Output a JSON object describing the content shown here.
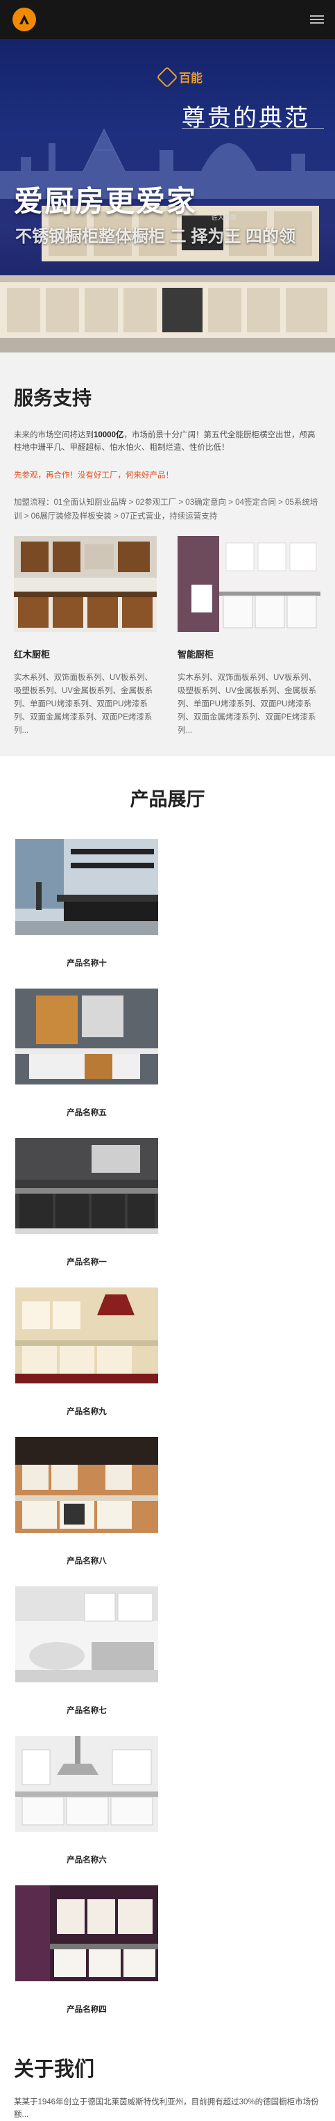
{
  "header": {
    "logo_icon": "orange-circle-logo",
    "menu_icon": "hamburger-icon"
  },
  "banner": {
    "brand_name": "百能",
    "slogan": "尊贵的典范",
    "headline": "爱厨房更爱家",
    "subline": "不锈钢橱柜整体橱柜 二 择为王 四的领",
    "small_note": "匠人典藏"
  },
  "services": {
    "title": "服务支持",
    "intro_before": "未来的市场空间将达到",
    "intro_bold": "10000亿",
    "intro_after": "，市场前景十分广阔！第五代全能厨柜横空出世，颅高柱地中珊平几、甲醛超标、怕水怕火、粗制烂造、性价比低！",
    "cta": "先参观，再合作！没有好工厂，何来好产品！",
    "process": "加盟流程：01全面认知厨业品牌 > 02参观工厂 > 03确定意向 > 04签定合同 > 05系统培训 > 06展厅装修及样板安装 > 07正式营业，持续运营支持",
    "cards": [
      {
        "name": "红木厨柜",
        "desc": "实木系列、双饰面板系列、UV板系列、吸塑板系列、UV金属板系列、金属板系列、单面PU烤漆系列、双面PU烤漆系列、双面金属烤漆系列、双面PE烤漆系列..."
      },
      {
        "name": "智能厨柜",
        "desc": "实木系列、双饰面板系列、UV板系列、吸塑板系列、UV金属板系列、金属板系列、单面PU烤漆系列、双面PU烤漆系列、双面金属烤漆系列、双面PE烤漆系列..."
      }
    ]
  },
  "products": {
    "title": "产品展厅",
    "items": [
      {
        "name": "产品名称十"
      },
      {
        "name": "产品名称五"
      },
      {
        "name": "产品名称一"
      },
      {
        "name": "产品名称九"
      },
      {
        "name": "产品名称八"
      },
      {
        "name": "产品名称七"
      },
      {
        "name": "产品名称六"
      },
      {
        "name": "产品名称四"
      }
    ]
  },
  "about": {
    "title": "关于我们",
    "text": "某某于1946年创立于德国北莱茵威斯特伐利亚州，目前拥有超过30%的德国橱柜市场份额..."
  },
  "colors": {
    "accent": "#f08a00",
    "header_bg": "#161616",
    "cta": "#e8501c",
    "section_bg": "#f2f2f2"
  }
}
